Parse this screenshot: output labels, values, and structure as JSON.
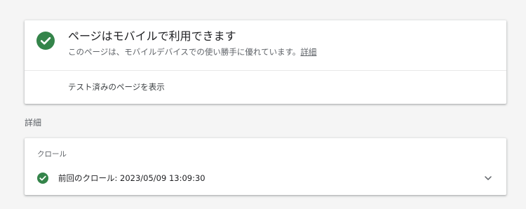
{
  "result": {
    "title": "ページはモバイルで利用できます",
    "description": "このページは、モバイルデバイスでの使い勝手に優れています。",
    "details_link": "詳細",
    "view_tested_page": "テスト済みのページを表示",
    "status_icon": "check-circle-icon"
  },
  "details": {
    "heading": "詳細",
    "crawl_section_label": "クロール",
    "last_crawl_text": "前回のクロール: 2023/05/09 13:09:30",
    "crawl_status_icon": "check-circle-icon",
    "expand_icon": "chevron-down-icon"
  },
  "colors": {
    "success_green": "#34844a",
    "background": "#f5f5f5",
    "card": "#ffffff",
    "secondary_text": "#5f6368"
  }
}
